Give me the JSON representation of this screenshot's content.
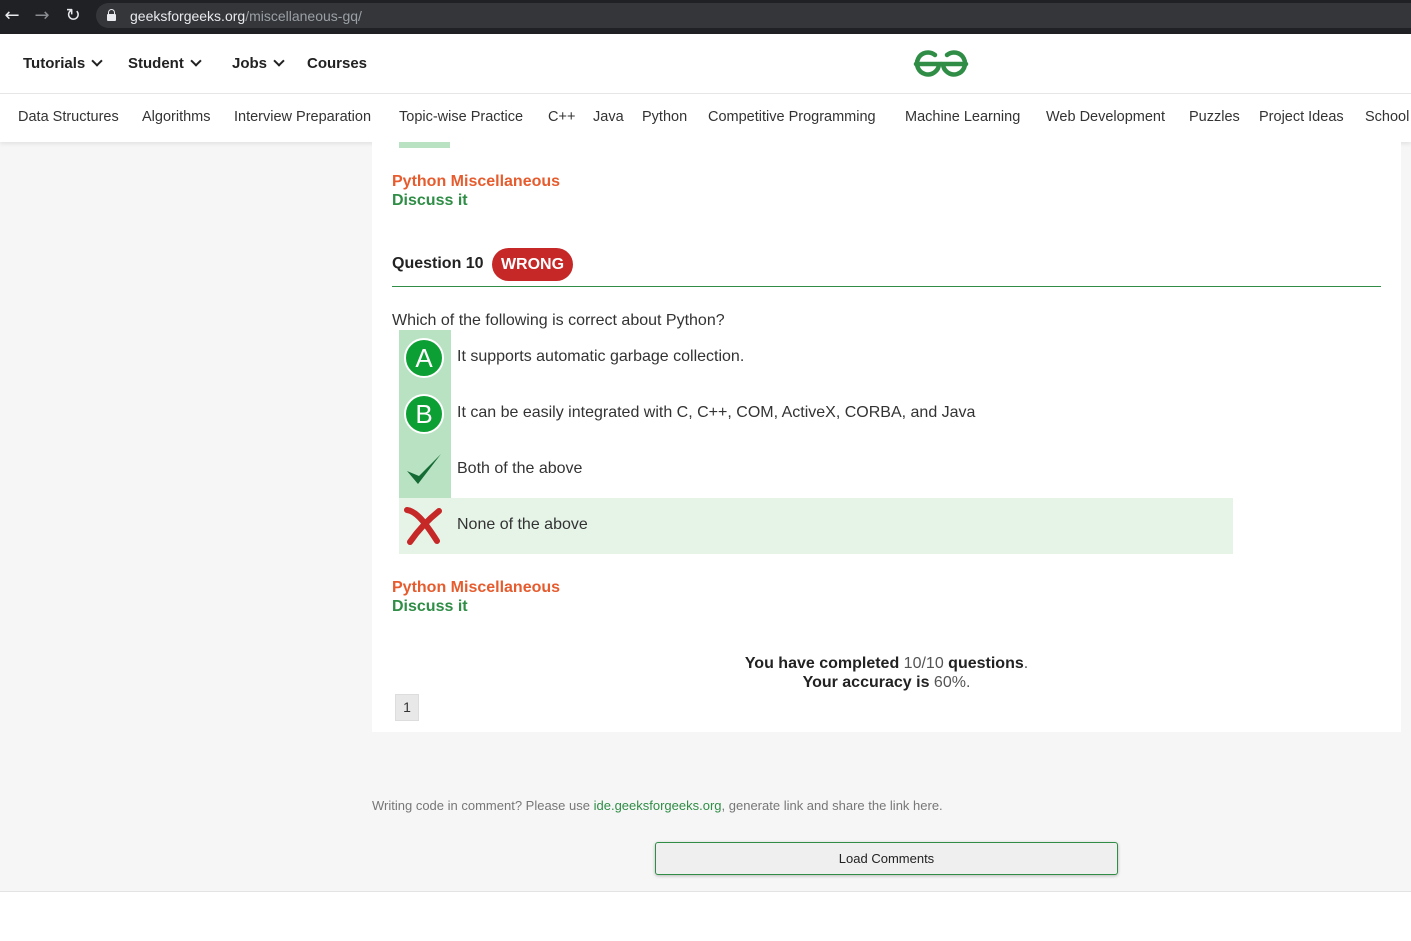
{
  "browser": {
    "url_domain": "geeksforgeeks.org",
    "url_path": "/miscellaneous-gq/"
  },
  "header": {
    "top_nav": [
      "Tutorials",
      "Student",
      "Jobs",
      "Courses"
    ],
    "sub_nav": [
      "Data Structures",
      "Algorithms",
      "Interview Preparation",
      "Topic-wise Practice",
      "C++",
      "Java",
      "Python",
      "Competitive Programming",
      "Machine Learning",
      "Web Development",
      "Puzzles",
      "Project Ideas",
      "School"
    ],
    "brand_color": "#2f8d46"
  },
  "prev_question": {
    "tag": "Python Miscellaneous",
    "discuss": "Discuss it"
  },
  "question": {
    "title": "Question 10",
    "status": "WRONG",
    "text": "Which of the following is correct about Python?",
    "options": [
      {
        "marker": "A",
        "text": "It supports automatic garbage collection."
      },
      {
        "marker": "B",
        "text": "It can be easily integrated with C, C++, COM, ActiveX, CORBA, and Java"
      },
      {
        "marker": "check-icon",
        "text": "Both of the above"
      },
      {
        "marker": "cross-icon",
        "text": "None of the above"
      }
    ],
    "tag": "Python Miscellaneous",
    "discuss": "Discuss it"
  },
  "result": {
    "completed_prefix": "You have completed",
    "completed_value": "10/10",
    "completed_suffix": "questions",
    "accuracy_prefix": "Your accuracy is",
    "accuracy_value": "60%"
  },
  "pagination": {
    "page": "1"
  },
  "comments": {
    "note_prefix": "Writing code in comment? Please use",
    "note_link": "ide.geeksforgeeks.org",
    "note_suffix": ", generate link and share the link here.",
    "load_button": "Load Comments"
  }
}
